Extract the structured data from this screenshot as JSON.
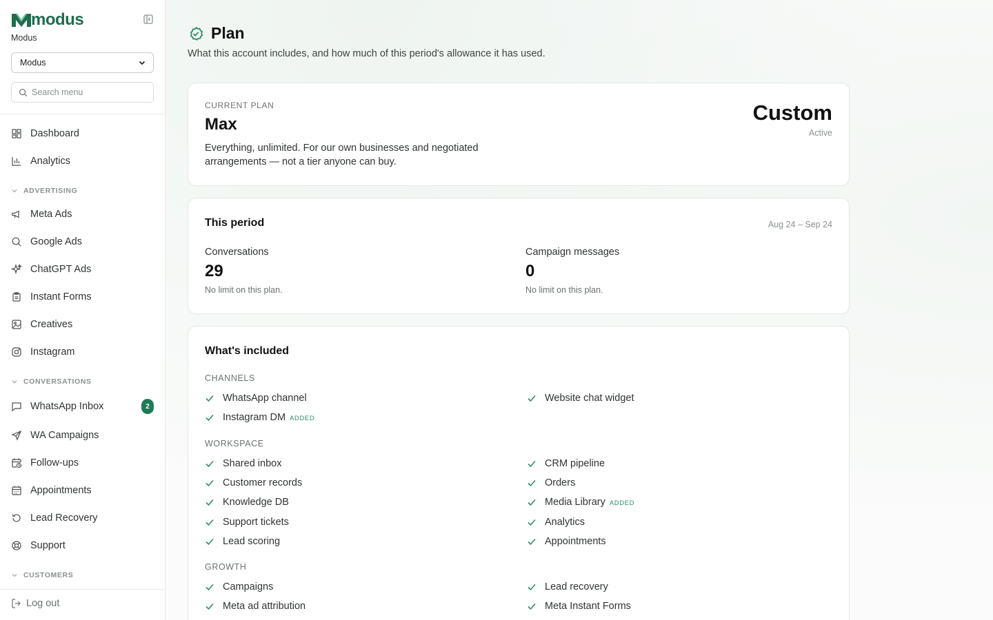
{
  "brand": {
    "name": "modus",
    "org_label": "Modus"
  },
  "org_select": {
    "value": "Modus"
  },
  "search": {
    "placeholder": "Search menu"
  },
  "nav": {
    "dashboard": "Dashboard",
    "analytics": "Analytics",
    "advertising_section": "ADVERTISING",
    "meta_ads": "Meta Ads",
    "google_ads": "Google Ads",
    "chatgpt_ads": "ChatGPT Ads",
    "instant_forms": "Instant Forms",
    "creatives": "Creatives",
    "instagram": "Instagram",
    "conversations_section": "CONVERSATIONS",
    "whatsapp_inbox": "WhatsApp Inbox",
    "whatsapp_inbox_badge": "2",
    "wa_campaigns": "WA Campaigns",
    "follow_ups": "Follow-ups",
    "appointments": "Appointments",
    "lead_recovery": "Lead Recovery",
    "support": "Support",
    "customers_section": "CUSTOMERS",
    "logout": "Log out"
  },
  "page": {
    "title": "Plan",
    "subtitle": "What this account includes, and how much of this period's allowance it has used."
  },
  "plan": {
    "eyebrow": "CURRENT PLAN",
    "name": "Max",
    "description": "Everything, unlimited. For our own businesses and negotiated arrangements — not a tier anyone can buy.",
    "tier": "Custom",
    "status": "Active"
  },
  "period": {
    "title": "This period",
    "range": "Aug 24 – Sep 24",
    "conversations_label": "Conversations",
    "conversations_value": "29",
    "conversations_note": "No limit on this plan.",
    "campaign_label": "Campaign messages",
    "campaign_value": "0",
    "campaign_note": "No limit on this plan."
  },
  "included": {
    "title": "What's included",
    "added_tag": "ADDED",
    "channels_label": "CHANNELS",
    "whatsapp_channel": "WhatsApp channel",
    "website_chat_widget": "Website chat widget",
    "instagram_dm": "Instagram DM",
    "workspace_label": "WORKSPACE",
    "shared_inbox": "Shared inbox",
    "crm_pipeline": "CRM pipeline",
    "customer_records": "Customer records",
    "orders": "Orders",
    "knowledge_db": "Knowledge DB",
    "media_library": "Media Library",
    "support_tickets": "Support tickets",
    "analytics": "Analytics",
    "lead_scoring": "Lead scoring",
    "appointments": "Appointments",
    "growth_label": "GROWTH",
    "campaigns": "Campaigns",
    "lead_recovery": "Lead recovery",
    "meta_ad_attribution": "Meta ad attribution",
    "meta_instant_forms": "Meta Instant Forms"
  },
  "colors": {
    "accent": "#1f7a57",
    "check": "#2f8c67"
  }
}
